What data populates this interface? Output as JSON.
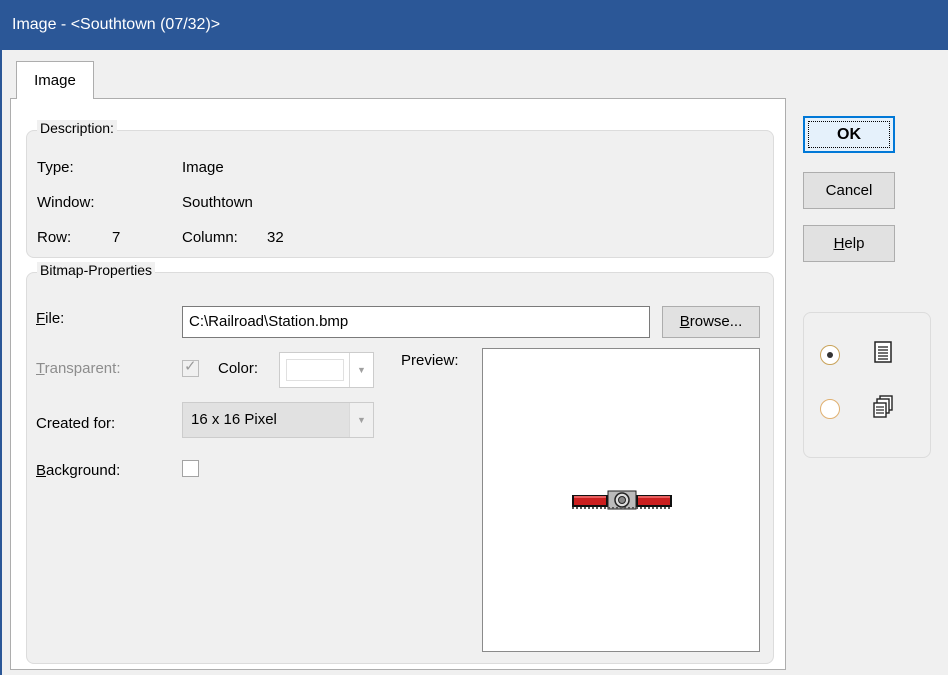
{
  "window": {
    "title": "Image - <Southtown (07/32)>"
  },
  "tab": {
    "label": "Image"
  },
  "description": {
    "title": "Description:",
    "type_label": "Type:",
    "type_value": "Image",
    "window_label": "Window:",
    "window_value": "Southtown",
    "row_label": "Row:",
    "row_value": "7",
    "column_label": "Column:",
    "column_value": "32"
  },
  "bitmap": {
    "title": "Bitmap-Properties",
    "file_label_u": "F",
    "file_label_rest": "ile:",
    "file_value": "C:\\Railroad\\Station.bmp",
    "browse_u": "B",
    "browse_rest": "rowse...",
    "transparent_u": "T",
    "transparent_rest": "ransparent:",
    "transparent_checked": true,
    "color_label": "Color:",
    "preview_label": "Preview:",
    "created_for_label": "Created for:",
    "created_for_value": "16 x 16 Pixel",
    "background_u": "B",
    "background_rest": "ackground:",
    "background_checked": false
  },
  "buttons": {
    "ok": "OK",
    "cancel": "Cancel",
    "help_u": "H",
    "help_rest": "elp"
  },
  "view_options": [
    {
      "icon": "single-page-icon",
      "selected": true
    },
    {
      "icon": "multi-page-icon",
      "selected": false
    }
  ],
  "colors": {
    "titlebar": "#2b5797",
    "accent": "#0078d7",
    "station_red": "#cc1f1f"
  }
}
